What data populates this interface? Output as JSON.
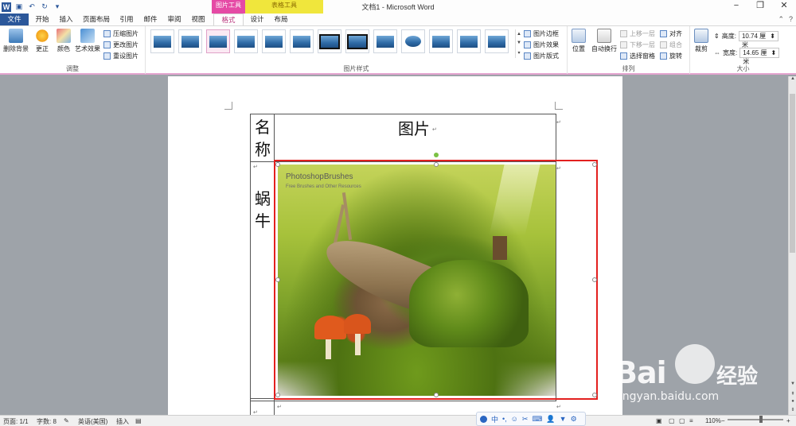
{
  "window": {
    "title": "文档1 - Microsoft Word",
    "context_pic_tools": "图片工具",
    "context_draw_tools": "表格工具",
    "controls": [
      "−",
      "❐",
      "✕"
    ]
  },
  "tabs": {
    "file": "文件",
    "items": [
      "开始",
      "插入",
      "页面布局",
      "引用",
      "邮件",
      "审阅",
      "视图",
      "格式",
      "设计",
      "布局"
    ]
  },
  "ribbon": {
    "adjust": {
      "remove_bg": "删除背景",
      "correct": "更正",
      "color": "颜色",
      "art_effects": "艺术效果",
      "compress": "压缩图片",
      "change": "更改图片",
      "reset": "重设图片",
      "label": "调整"
    },
    "styles": {
      "label": "图片样式",
      "border": "图片边框",
      "effects": "图片效果",
      "layout": "图片版式"
    },
    "arrange": {
      "label": "排列",
      "position": "位置",
      "wrap": "自动换行",
      "forward": "上移一层",
      "backward": "下移一层",
      "selection_pane": "选择窗格",
      "align": "对齐",
      "group": "组合",
      "rotate": "旋转"
    },
    "size": {
      "label": "大小",
      "crop": "裁剪",
      "height_label": "高度:",
      "height_value": "10.74 厘米",
      "width_label": "宽度:",
      "width_value": "14.65 厘米"
    }
  },
  "document": {
    "header_name": "名称",
    "header_pic": "图片",
    "row_name": "蜗牛",
    "watermark_title": "PhotoshopBrushes",
    "watermark_sub": "Free Brushes and Other Resources"
  },
  "statusbar": {
    "page": "页面: 1/1",
    "words": "字数: 8",
    "language": "英语(美国)",
    "mode": "插入",
    "zoom": "110%"
  },
  "ime": {
    "lang": "中"
  },
  "baidu_watermark": {
    "brand": "Bai",
    "cn": "经验",
    "url": "jingyan.baidu.com"
  }
}
